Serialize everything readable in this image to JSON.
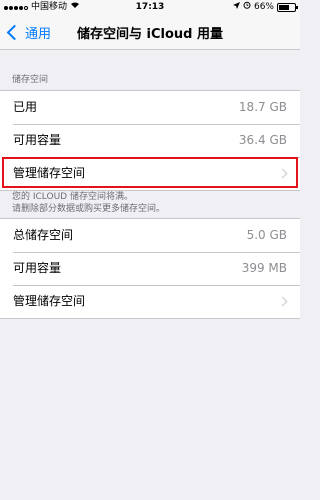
{
  "status_bar": {
    "carrier": "中国移动",
    "time": "17:13",
    "battery_text": "66%",
    "battery_level": 0.66
  },
  "nav": {
    "back_label": "通用",
    "title": "储存空间与 iCloud 用量"
  },
  "storage": {
    "header": "储存空间",
    "rows": [
      {
        "label": "已用",
        "value": "18.7 GB"
      },
      {
        "label": "可用容量",
        "value": "36.4 GB"
      },
      {
        "label": "管理储存空间"
      }
    ]
  },
  "icloud": {
    "note_line1": "您的 ICLOUD 储存空间将满。",
    "note_line2": "请删除部分数据或购买更多储存空间。",
    "rows": [
      {
        "label": "总储存空间",
        "value": "5.0 GB"
      },
      {
        "label": "可用容量",
        "value": "399 MB"
      },
      {
        "label": "管理储存空间"
      }
    ]
  }
}
